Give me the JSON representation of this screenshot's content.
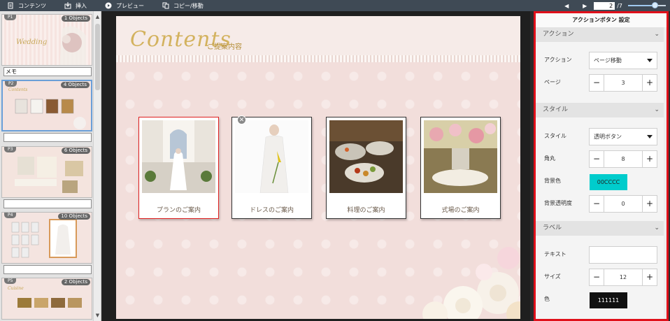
{
  "toolbar": {
    "contents_label": "コンテンツ",
    "insert_label": "挿入",
    "preview_label": "プレビュー",
    "copy_move_label": "コピー/移動",
    "current_page": "2",
    "total_pages": "/7",
    "zoom_level": 0.7
  },
  "thumbnails": [
    {
      "page": "P1",
      "objects": "1 Objects",
      "memo": "メモ"
    },
    {
      "page": "P2",
      "objects": "4 Objects",
      "memo": ""
    },
    {
      "page": "P3",
      "objects": "6 Objects",
      "memo": ""
    },
    {
      "page": "P4",
      "objects": "10 Objects",
      "memo": ""
    },
    {
      "page": "P5",
      "objects": "2 Objects",
      "memo": ""
    }
  ],
  "slide": {
    "title": "Contents",
    "subtitle": "ご提案内容",
    "cards": [
      {
        "caption": "プランのご案内"
      },
      {
        "caption": "ドレスのご案内"
      },
      {
        "caption": "料理のご案内"
      },
      {
        "caption": "式場のご案内"
      }
    ]
  },
  "panel": {
    "title": "アクションボタン 設定",
    "action_section": "アクション",
    "action_label": "アクション",
    "action_value": "ページ移動",
    "page_label": "ページ",
    "page_value": "3",
    "style_section": "スタイル",
    "style_label": "スタイル",
    "style_value": "透明ボタン",
    "radius_label": "角丸",
    "radius_value": "8",
    "bgcolor_label": "背景色",
    "bgcolor_value": "00CCCC",
    "bg_opacity_label": "背景透明度",
    "bg_opacity_value": "0",
    "label_section": "ラベル",
    "text_label": "テキスト",
    "text_value": "",
    "size_label": "サイズ",
    "size_value": "12",
    "color_label": "色",
    "color_value": "111111"
  },
  "colors": {
    "toolbar_bg": "#3f4a55",
    "selection_border": "#e0101a",
    "swatch_cyan": "#00cccc",
    "swatch_dark": "#111111"
  }
}
